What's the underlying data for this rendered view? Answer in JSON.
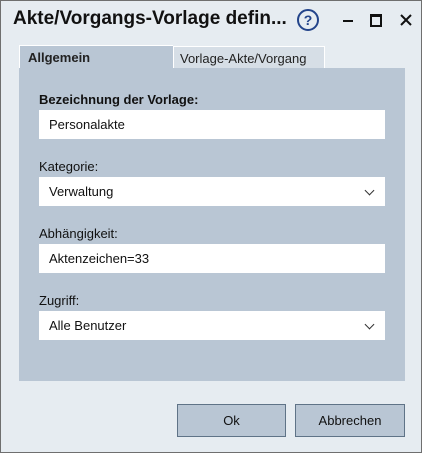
{
  "window": {
    "title": "Akte/Vorgangs-Vorlage defin..."
  },
  "titlebar": {
    "help_label": "?",
    "icons": [
      "help-icon",
      "minimize-icon",
      "maximize-icon",
      "close-icon"
    ],
    "close_label": "✕"
  },
  "tabs": [
    {
      "label": "Allgemein",
      "active": true
    },
    {
      "label": "Vorlage-Akte/Vorgang",
      "active": false
    }
  ],
  "form": {
    "name_label": "Bezeichnung der Vorlage:",
    "name_value": "Personalakte",
    "category_label": "Kategorie:",
    "category_value": "Verwaltung",
    "dependency_label": "Abhängigkeit:",
    "dependency_value": "Aktenzeichen=33",
    "access_label": "Zugriff:",
    "access_value": "Alle Benutzer"
  },
  "buttons": {
    "ok": "Ok",
    "cancel": "Abbrechen"
  },
  "colors": {
    "window_bg": "#e6ecf1",
    "panel_bg": "#b9c6d4",
    "help_icon": "#23448a"
  }
}
